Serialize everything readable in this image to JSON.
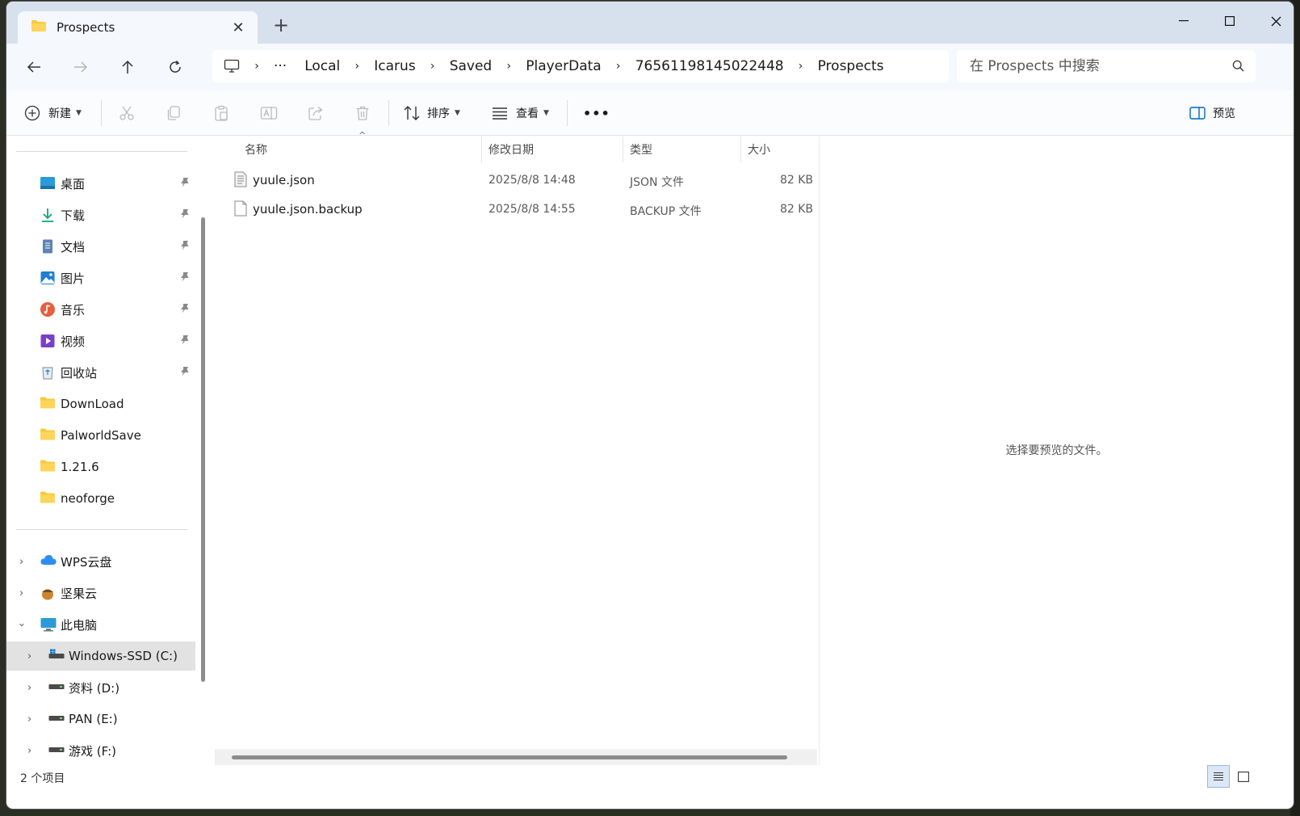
{
  "window": {
    "tab_title": "Prospects",
    "new_tab_symbol": "+",
    "close_tab_symbol": "✕",
    "controls": {
      "minimize": "—",
      "maximize": "☐",
      "close": "✕"
    }
  },
  "navigation": {
    "breadcrumbs": [
      "Local",
      "Icarus",
      "Saved",
      "PlayerData",
      "76561198145022448",
      "Prospects"
    ],
    "more_symbol": "···",
    "separator": "›",
    "search_placeholder": "在 Prospects 中搜索"
  },
  "toolbar": {
    "new_label": "新建",
    "sort_label": "排序",
    "view_label": "查看",
    "more_label": "•••",
    "preview_label": "预览"
  },
  "sidebar": {
    "quick_access": [
      {
        "label": "桌面",
        "icon": "desktop-icon",
        "pinned": true
      },
      {
        "label": "下载",
        "icon": "download-icon",
        "pinned": true
      },
      {
        "label": "文档",
        "icon": "documents-icon",
        "pinned": true
      },
      {
        "label": "图片",
        "icon": "pictures-icon",
        "pinned": true
      },
      {
        "label": "音乐",
        "icon": "music-icon",
        "pinned": true
      },
      {
        "label": "视频",
        "icon": "videos-icon",
        "pinned": true
      },
      {
        "label": "回收站",
        "icon": "recycle-bin-icon",
        "pinned": true
      },
      {
        "label": "DownLoad",
        "icon": "folder-icon",
        "pinned": false
      },
      {
        "label": "PalworldSave",
        "icon": "folder-icon",
        "pinned": false
      },
      {
        "label": "1.21.6",
        "icon": "folder-icon",
        "pinned": false
      },
      {
        "label": "neoforge",
        "icon": "folder-icon",
        "pinned": false
      }
    ],
    "locations": [
      {
        "label": "WPS云盘",
        "icon": "wps-cloud-icon",
        "expanded": false
      },
      {
        "label": "坚果云",
        "icon": "jianguoyun-icon",
        "expanded": false
      },
      {
        "label": "此电脑",
        "icon": "this-pc-icon",
        "expanded": true
      }
    ],
    "drives": [
      {
        "label": "Windows-SSD (C:)",
        "icon": "windows-drive-icon",
        "selected": true
      },
      {
        "label": "资料 (D:)",
        "icon": "drive-icon",
        "selected": false
      },
      {
        "label": "PAN (E:)",
        "icon": "drive-icon",
        "selected": false
      },
      {
        "label": "游戏 (F:)",
        "icon": "drive-icon",
        "selected": false
      }
    ]
  },
  "file_list": {
    "columns": [
      "名称",
      "修改日期",
      "类型",
      "大小"
    ],
    "sorted_by": "名称",
    "rows": [
      {
        "name": "yuule.json",
        "modified": "2025/8/8 14:48",
        "type": "JSON 文件",
        "size": "82 KB"
      },
      {
        "name": "yuule.json.backup",
        "modified": "2025/8/8 14:55",
        "type": "BACKUP 文件",
        "size": "82 KB"
      }
    ]
  },
  "preview_pane": {
    "message": "选择要预览的文件。"
  },
  "status_bar": {
    "item_count": "2 个项目"
  },
  "colors": {
    "accent": "#0067c0",
    "titlebar": "#d7e1ee",
    "folder": "#f8c93c"
  }
}
